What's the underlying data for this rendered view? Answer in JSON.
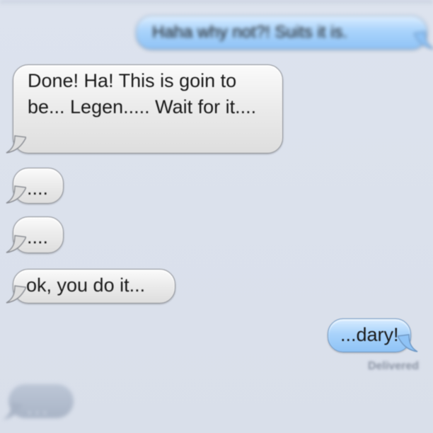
{
  "conversation": {
    "messages": [
      {
        "side": "sent",
        "text": "Haha why not?! Suits it is."
      },
      {
        "side": "received",
        "text": "Done! Ha! This is goin to be... Legen..... Wait for it...."
      },
      {
        "side": "received",
        "text": "...."
      },
      {
        "side": "received",
        "text": "...."
      },
      {
        "side": "received",
        "text": "ok, you do it..."
      },
      {
        "side": "sent",
        "text": "...dary!"
      }
    ],
    "status": "Delivered",
    "typing_indicator": "..."
  },
  "colors": {
    "background": "#dbe1ec",
    "sent_bubble": "#a9d3fb",
    "received_bubble": "#ececec"
  }
}
